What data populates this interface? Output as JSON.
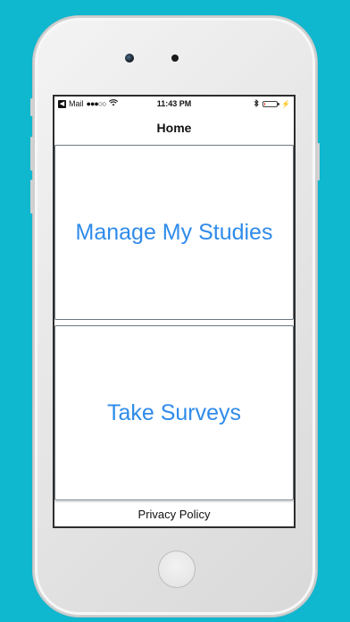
{
  "status_bar": {
    "back_app": "Mail",
    "signal": "●●●○○",
    "time": "11:43 PM",
    "battery_level": 0.1,
    "battery_color": "#e0312b"
  },
  "nav": {
    "title": "Home"
  },
  "tiles": [
    {
      "label": "Manage My Studies"
    },
    {
      "label": "Take Surveys"
    }
  ],
  "footer": {
    "privacy_label": "Privacy Policy"
  },
  "colors": {
    "background": "#0fb7cf",
    "accent": "#2f8bea"
  }
}
